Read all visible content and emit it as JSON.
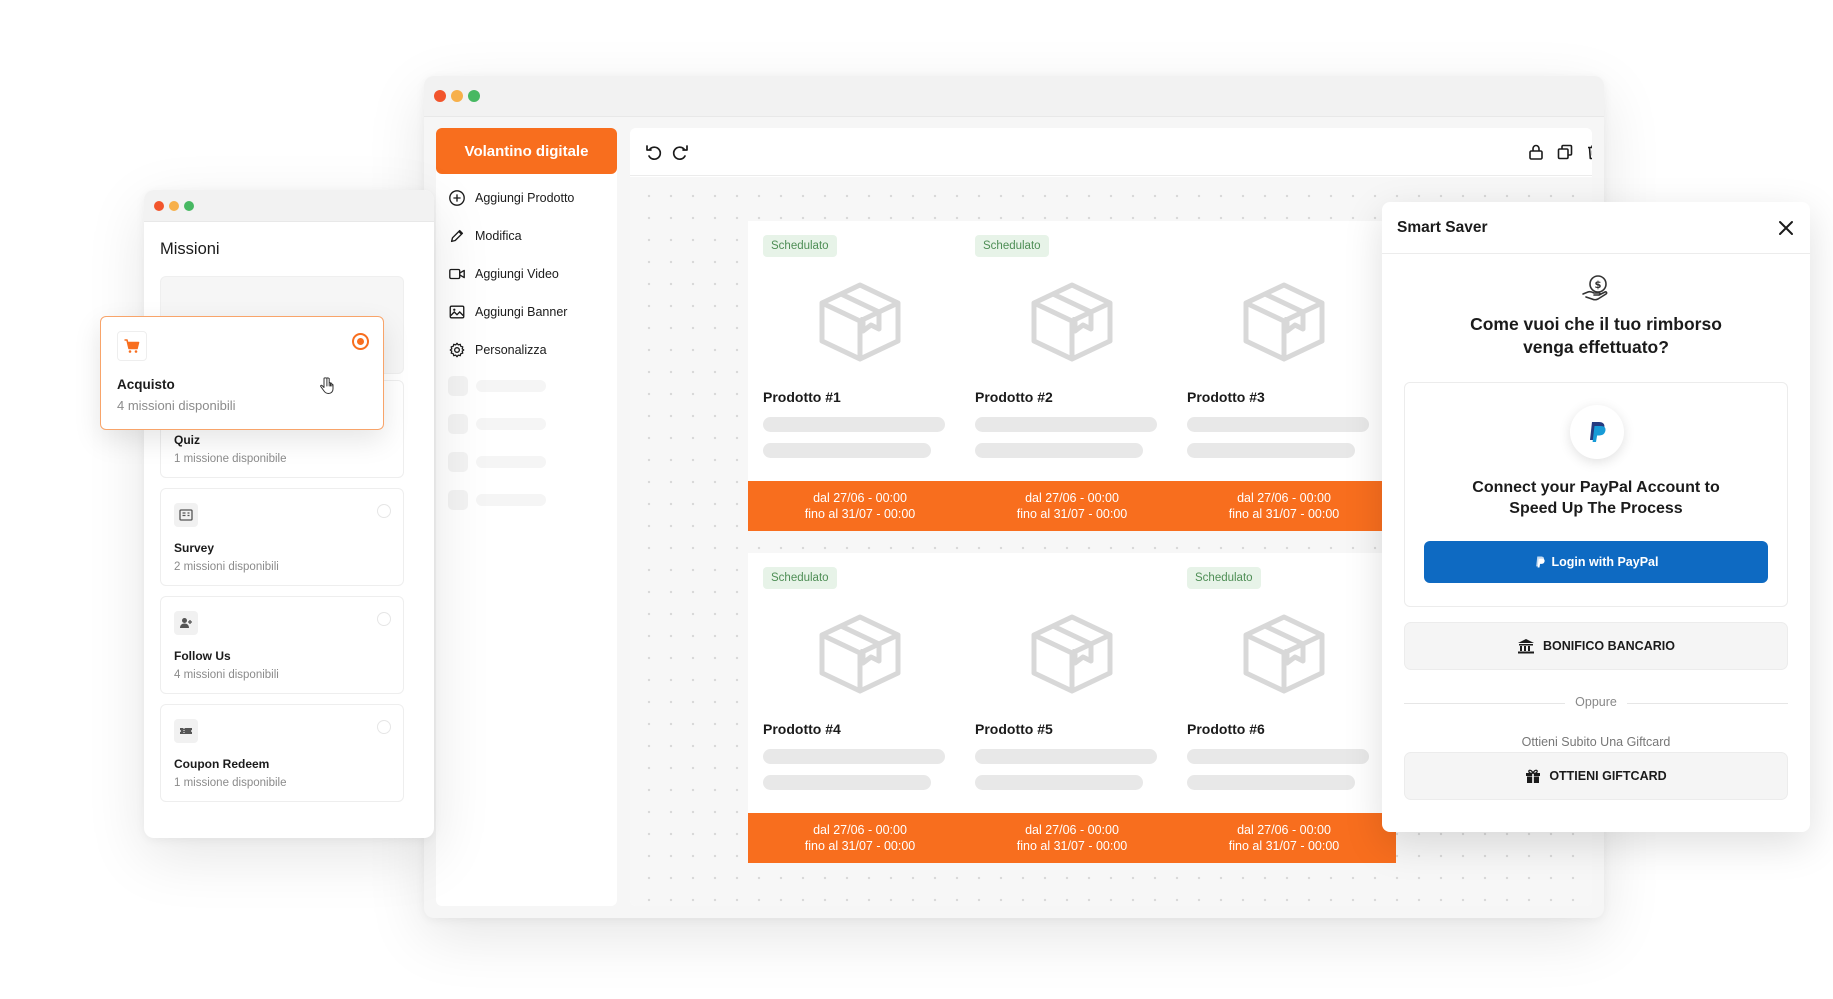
{
  "main_window": {
    "sidebar": {
      "title": "Volantino digitale",
      "items": [
        {
          "label": "Aggiungi Prodotto",
          "icon": "plus-circle-icon"
        },
        {
          "label": "Modifica",
          "icon": "pencil-icon"
        },
        {
          "label": "Aggiungi Video",
          "icon": "video-icon"
        },
        {
          "label": "Aggiungi Banner",
          "icon": "image-icon"
        },
        {
          "label": "Personalizza",
          "icon": "gear-icon"
        }
      ]
    },
    "toolbar": {
      "left_icons": [
        "undo-icon",
        "redo-icon"
      ],
      "right_icons": [
        "lock-icon",
        "duplicate-icon",
        "trash-icon"
      ]
    },
    "products": [
      {
        "name": "Prodotto #1",
        "badge": "Schedulato",
        "date_from": "dal 27/06 - 00:00",
        "date_to": "fino al 31/07 - 00:00"
      },
      {
        "name": "Prodotto #2",
        "badge": "Schedulato",
        "date_from": "dal 27/06 - 00:00",
        "date_to": "fino al 31/07 - 00:00"
      },
      {
        "name": "Prodotto #3",
        "badge": "",
        "date_from": "dal 27/06 - 00:00",
        "date_to": "fino al 31/07 - 00:00"
      },
      {
        "name": "Prodotto #4",
        "badge": "Schedulato",
        "date_from": "dal 27/06 - 00:00",
        "date_to": "fino al 31/07 - 00:00"
      },
      {
        "name": "Prodotto #5",
        "badge": "",
        "date_from": "dal 27/06 - 00:00",
        "date_to": "fino al 31/07 - 00:00"
      },
      {
        "name": "Prodotto #6",
        "badge": "Schedulato",
        "date_from": "dal 27/06 - 00:00",
        "date_to": "fino al 31/07 - 00:00"
      }
    ]
  },
  "missions_window": {
    "title": "Missioni",
    "selected": {
      "title": "Acquisto",
      "subtitle": "4 missioni disponibili",
      "icon": "cart-icon"
    },
    "items": [
      {
        "title": "Quiz",
        "subtitle": "1 missione disponibile",
        "icon": "quiz-icon"
      },
      {
        "title": "Survey",
        "subtitle": "2 missioni disponibili",
        "icon": "survey-icon"
      },
      {
        "title": "Follow Us",
        "subtitle": "4 missioni disponibili",
        "icon": "follow-icon"
      },
      {
        "title": "Coupon Redeem",
        "subtitle": "1 missione disponibile",
        "icon": "coupon-icon"
      }
    ]
  },
  "smart_saver": {
    "title": "Smart Saver",
    "question": "Come vuoi che il tuo rimborso venga effettuato?",
    "paypal_text": "Connect your PayPal Account to Speed Up The Process",
    "paypal_button": "Login with PayPal",
    "bank_button": "BONIFICO BANCARIO",
    "divider": "Oppure",
    "gift_subtitle": "Ottieni Subito Una Giftcard",
    "gift_button": "OTTIENI GIFTCARD"
  },
  "colors": {
    "accent": "#f86e1e",
    "paypal_blue": "#0e6ac2",
    "badge_green_bg": "#e7f3e8",
    "badge_green_text": "#4e8e55"
  }
}
